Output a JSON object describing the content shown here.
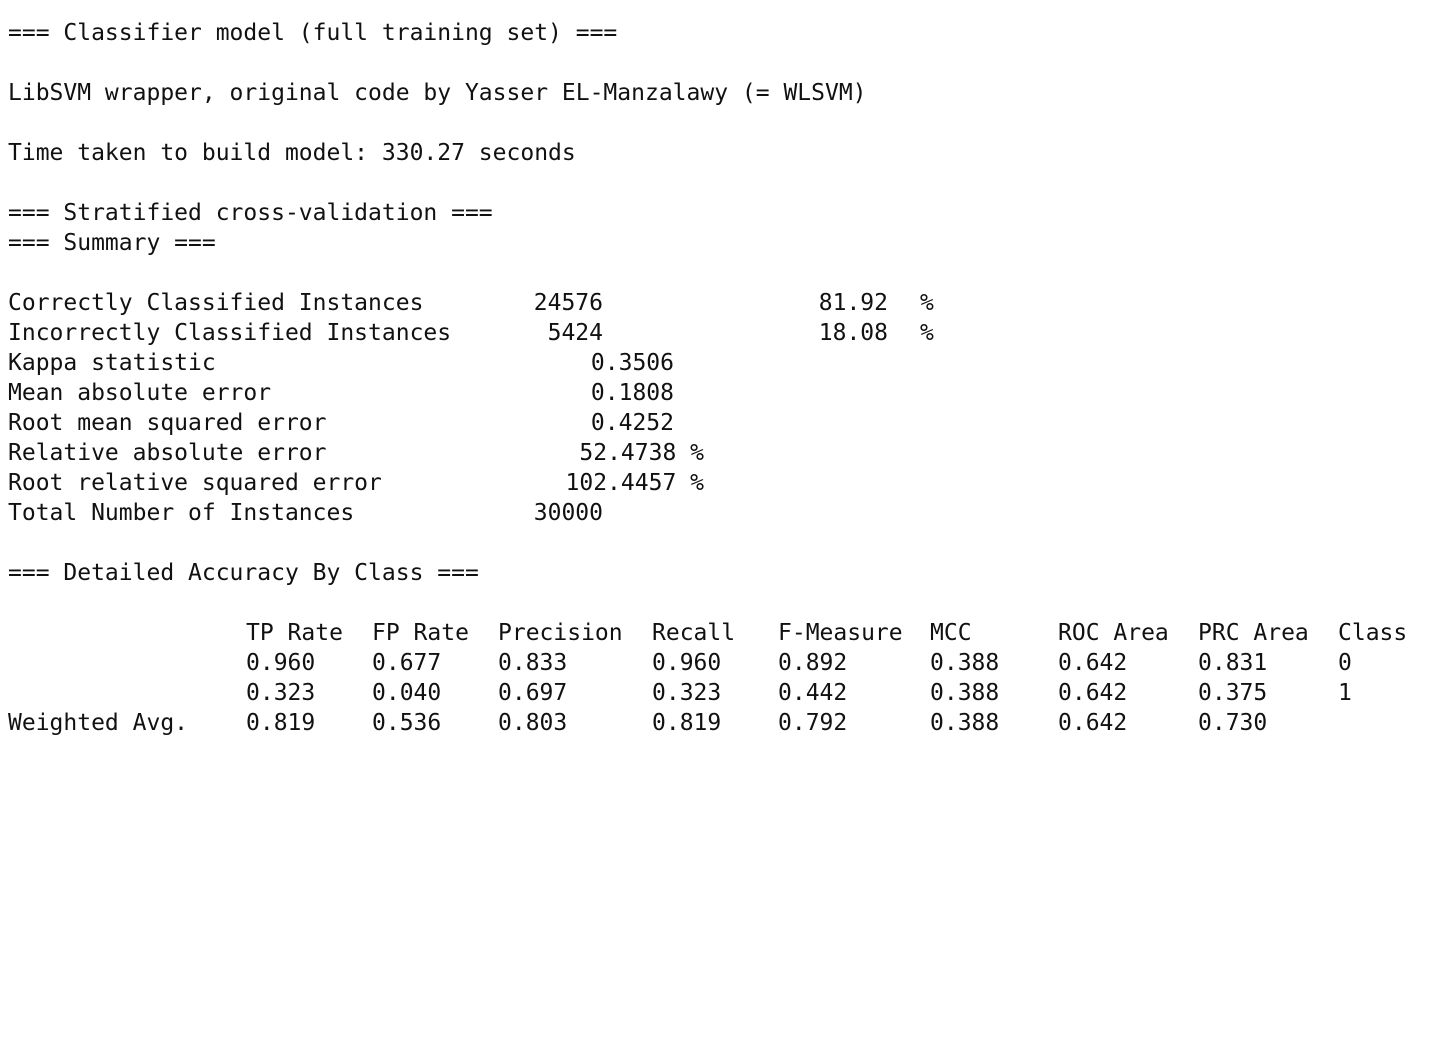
{
  "header": {
    "model_title": "=== Classifier model (full training set) ===",
    "wrapper_line": "LibSVM wrapper, original code by Yasser EL-Manzalawy (= WLSVM)",
    "time_line": "Time taken to build model: 330.27 seconds",
    "cv_title": "=== Stratified cross-validation ===",
    "summary_title": "=== Summary ==="
  },
  "summary": {
    "correct": {
      "label": "Correctly Classified Instances",
      "count": "24576",
      "percent": "81.92",
      "pct_sign": "%"
    },
    "incorrect": {
      "label": "Incorrectly Classified Instances",
      "count": "5424",
      "percent": "18.08",
      "pct_sign": "%"
    },
    "kappa": {
      "label": "Kappa statistic",
      "value": "0.3506"
    },
    "mae": {
      "label": "Mean absolute error",
      "value": "0.1808"
    },
    "rmse": {
      "label": "Root mean squared error",
      "value": "0.4252"
    },
    "rae": {
      "label": "Relative absolute error",
      "value": "52.4738 %"
    },
    "rrse": {
      "label": "Root relative squared error",
      "value": "102.4457 %"
    },
    "total": {
      "label": "Total Number of Instances",
      "value": "30000"
    }
  },
  "detailed": {
    "title": "=== Detailed Accuracy By Class ===",
    "headers": [
      "",
      "TP Rate",
      "FP Rate",
      "Precision",
      "Recall",
      "F-Measure",
      "MCC",
      "ROC Area",
      "PRC Area",
      "Class"
    ],
    "rows": [
      [
        "",
        "0.960",
        "0.677",
        "0.833",
        "0.960",
        "0.892",
        "0.388",
        "0.642",
        "0.831",
        "0"
      ],
      [
        "",
        "0.323",
        "0.040",
        "0.697",
        "0.323",
        "0.442",
        "0.388",
        "0.642",
        "0.375",
        "1"
      ],
      [
        "Weighted Avg.",
        "0.819",
        "0.536",
        "0.803",
        "0.819",
        "0.792",
        "0.388",
        "0.642",
        "0.730",
        ""
      ]
    ]
  }
}
